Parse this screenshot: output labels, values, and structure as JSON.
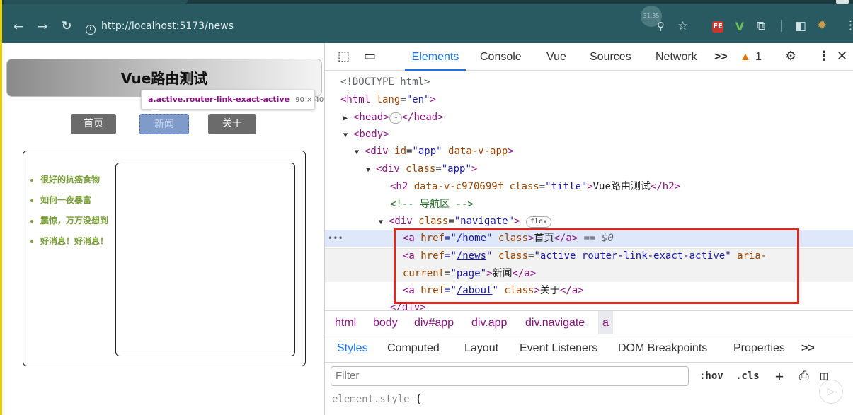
{
  "browser": {
    "url": "http://localhost:5173/news",
    "avatar_badge": "31.35",
    "ext_fe_label": "FE",
    "ext_vue_label": "V"
  },
  "page": {
    "title": "Vue路由测试",
    "nav": [
      {
        "label": "首页"
      },
      {
        "label": "新闻"
      },
      {
        "label": "关于"
      }
    ],
    "tooltip": {
      "selector": "a.active.router-link-exact-active",
      "size": "90 × 40"
    },
    "news": [
      "很好的抗癌食物",
      "如何一夜暴富",
      "震惊，万万没想到",
      "好消息！好消息！"
    ]
  },
  "devtools": {
    "tabs": [
      "Elements",
      "Console",
      "Vue",
      "Sources",
      "Network"
    ],
    "active_tab": "Elements",
    "more_tabs": ">>",
    "warning_count": "1",
    "code": {
      "doctype": "<!DOCTYPE html>",
      "html_open_tag": "<html ",
      "html_attr": "lang",
      "html_val": "\"en\"",
      "html_close": ">",
      "head_open": "<head>",
      "head_ellipsis": "⋯",
      "head_close": "</head>",
      "body_open": "<body>",
      "div_app_tag": "<div ",
      "div_app_attr1": "id",
      "div_app_val1": "\"app\"",
      "div_app_attr2": " data-v-app",
      "div_app_close": ">",
      "div_class_tag": "<div ",
      "div_class_attr": "class",
      "div_class_val": "\"app\"",
      "div_class_close": ">",
      "h2_tag": "<h2 ",
      "h2_attr1": "data-v-c970699f",
      "h2_attr2": " class",
      "h2_val2": "\"title\"",
      "h2_gt": ">",
      "h2_text": "Vue路由测试",
      "h2_close": "</h2>",
      "comment": "<!-- 导航区 -->",
      "nav_tag": "<div ",
      "nav_attr": "class",
      "nav_val": "\"navigate\"",
      "nav_gt": ">",
      "nav_badge": "flex",
      "a1_tag": "<a ",
      "a1_attr": "href",
      "a1_q1": "=\"",
      "a1_href": "/home",
      "a1_q2": "\"",
      "a1_attr2": " class",
      "a1_gt": ">",
      "a1_text": "首页",
      "a1_close": "</a>",
      "a1_eq": " == $0",
      "a2_tag": "<a ",
      "a2_attr": "href",
      "a2_q1": "=\"",
      "a2_href": "/news",
      "a2_q2": "\"",
      "a2_attr2": " class",
      "a2_val2": "\"active router-link-exact-active\"",
      "a2_attr3": " aria-",
      "a2_line2_attr": "current",
      "a2_line2_val": "\"page\"",
      "a2_gt": ">",
      "a2_text": "新闻",
      "a2_close": "</a>",
      "a3_tag": "<a ",
      "a3_attr": "href",
      "a3_q1": "=\"",
      "a3_href": "/about",
      "a3_q2": "\"",
      "a3_attr2": " class",
      "a3_gt": ">",
      "a3_text": "关于",
      "a3_close": "</a>",
      "div_close": "</div>",
      "row_ellipsis": "•••"
    },
    "breadcrumbs": [
      "html",
      "body",
      "div#app",
      "div.app",
      "div.navigate",
      "a"
    ],
    "subtabs": [
      "Styles",
      "Computed",
      "Layout",
      "Event Listeners",
      "DOM Breakpoints",
      "Properties"
    ],
    "subtabs_more": ">>",
    "filter_placeholder": "Filter",
    "hov": ":hov",
    "cls": ".cls",
    "element_style": "element.style",
    "element_style_brace": "{"
  }
}
